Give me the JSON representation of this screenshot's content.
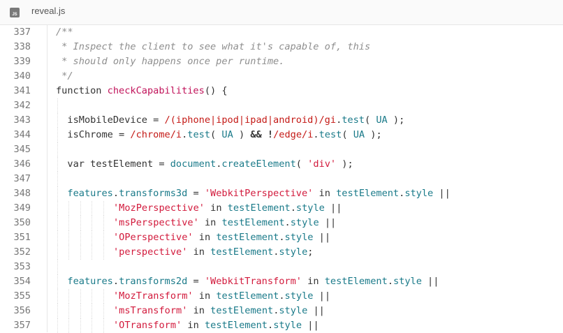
{
  "tab": {
    "icon_text": "JS",
    "filename": "reveal.js"
  },
  "lines": [
    {
      "num": "337",
      "indent": 1,
      "tokens": [
        {
          "t": "/**",
          "c": "com"
        }
      ]
    },
    {
      "num": "338",
      "indent": 1,
      "tokens": [
        {
          "t": " * Inspect the client to see what it's capable of, this",
          "c": "com"
        }
      ]
    },
    {
      "num": "339",
      "indent": 1,
      "tokens": [
        {
          "t": " * should only happens once per runtime.",
          "c": "com"
        }
      ]
    },
    {
      "num": "340",
      "indent": 1,
      "tokens": [
        {
          "t": " */",
          "c": "com"
        }
      ]
    },
    {
      "num": "341",
      "indent": 1,
      "tokens": [
        {
          "t": "function ",
          "c": "kw"
        },
        {
          "t": "checkCapabilities",
          "c": "fn"
        },
        {
          "t": "() {",
          "c": ""
        }
      ]
    },
    {
      "num": "342",
      "indent": 1,
      "tokens": []
    },
    {
      "num": "343",
      "indent": 2,
      "tokens": [
        {
          "t": "isMobileDevice = ",
          "c": ""
        },
        {
          "t": "/(iphone|ipod|ipad|android)/gi",
          "c": "re"
        },
        {
          "t": ".",
          "c": ""
        },
        {
          "t": "test",
          "c": "prop"
        },
        {
          "t": "( ",
          "c": ""
        },
        {
          "t": "UA",
          "c": "prop"
        },
        {
          "t": " );",
          "c": ""
        }
      ]
    },
    {
      "num": "344",
      "indent": 2,
      "tokens": [
        {
          "t": "isChrome = ",
          "c": ""
        },
        {
          "t": "/chrome/i",
          "c": "re"
        },
        {
          "t": ".",
          "c": ""
        },
        {
          "t": "test",
          "c": "prop"
        },
        {
          "t": "( ",
          "c": ""
        },
        {
          "t": "UA",
          "c": "prop"
        },
        {
          "t": " ) ",
          "c": ""
        },
        {
          "t": "&&",
          "c": "bold"
        },
        {
          "t": " ",
          "c": ""
        },
        {
          "t": "!",
          "c": "bold"
        },
        {
          "t": "/edge/i",
          "c": "re"
        },
        {
          "t": ".",
          "c": ""
        },
        {
          "t": "test",
          "c": "prop"
        },
        {
          "t": "( ",
          "c": ""
        },
        {
          "t": "UA",
          "c": "prop"
        },
        {
          "t": " );",
          "c": ""
        }
      ]
    },
    {
      "num": "345",
      "indent": 2,
      "tokens": []
    },
    {
      "num": "346",
      "indent": 2,
      "tokens": [
        {
          "t": "var ",
          "c": "kw"
        },
        {
          "t": "testElement = ",
          "c": ""
        },
        {
          "t": "document",
          "c": "prop"
        },
        {
          "t": ".",
          "c": ""
        },
        {
          "t": "createElement",
          "c": "prop"
        },
        {
          "t": "( ",
          "c": ""
        },
        {
          "t": "'div'",
          "c": "str"
        },
        {
          "t": " );",
          "c": ""
        }
      ]
    },
    {
      "num": "347",
      "indent": 2,
      "tokens": []
    },
    {
      "num": "348",
      "indent": 2,
      "tokens": [
        {
          "t": "features",
          "c": "prop"
        },
        {
          "t": ".",
          "c": ""
        },
        {
          "t": "transforms3d",
          "c": "prop"
        },
        {
          "t": " = ",
          "c": ""
        },
        {
          "t": "'WebkitPerspective'",
          "c": "str"
        },
        {
          "t": " in ",
          "c": "kw"
        },
        {
          "t": "testElement",
          "c": "prop"
        },
        {
          "t": ".",
          "c": ""
        },
        {
          "t": "style",
          "c": "prop"
        },
        {
          "t": " ||",
          "c": ""
        }
      ]
    },
    {
      "num": "349",
      "indent": 6,
      "tokens": [
        {
          "t": "'MozPerspective'",
          "c": "str"
        },
        {
          "t": " in ",
          "c": "kw"
        },
        {
          "t": "testElement",
          "c": "prop"
        },
        {
          "t": ".",
          "c": ""
        },
        {
          "t": "style",
          "c": "prop"
        },
        {
          "t": " ||",
          "c": ""
        }
      ]
    },
    {
      "num": "350",
      "indent": 6,
      "tokens": [
        {
          "t": "'msPerspective'",
          "c": "str"
        },
        {
          "t": " in ",
          "c": "kw"
        },
        {
          "t": "testElement",
          "c": "prop"
        },
        {
          "t": ".",
          "c": ""
        },
        {
          "t": "style",
          "c": "prop"
        },
        {
          "t": " ||",
          "c": ""
        }
      ]
    },
    {
      "num": "351",
      "indent": 6,
      "tokens": [
        {
          "t": "'OPerspective'",
          "c": "str"
        },
        {
          "t": " in ",
          "c": "kw"
        },
        {
          "t": "testElement",
          "c": "prop"
        },
        {
          "t": ".",
          "c": ""
        },
        {
          "t": "style",
          "c": "prop"
        },
        {
          "t": " ||",
          "c": ""
        }
      ]
    },
    {
      "num": "352",
      "indent": 6,
      "tokens": [
        {
          "t": "'perspective'",
          "c": "str"
        },
        {
          "t": " in ",
          "c": "kw"
        },
        {
          "t": "testElement",
          "c": "prop"
        },
        {
          "t": ".",
          "c": ""
        },
        {
          "t": "style",
          "c": "prop"
        },
        {
          "t": ";",
          "c": ""
        }
      ]
    },
    {
      "num": "353",
      "indent": 2,
      "tokens": []
    },
    {
      "num": "354",
      "indent": 2,
      "tokens": [
        {
          "t": "features",
          "c": "prop"
        },
        {
          "t": ".",
          "c": ""
        },
        {
          "t": "transforms2d",
          "c": "prop"
        },
        {
          "t": " = ",
          "c": ""
        },
        {
          "t": "'WebkitTransform'",
          "c": "str"
        },
        {
          "t": " in ",
          "c": "kw"
        },
        {
          "t": "testElement",
          "c": "prop"
        },
        {
          "t": ".",
          "c": ""
        },
        {
          "t": "style",
          "c": "prop"
        },
        {
          "t": " ||",
          "c": ""
        }
      ]
    },
    {
      "num": "355",
      "indent": 6,
      "tokens": [
        {
          "t": "'MozTransform'",
          "c": "str"
        },
        {
          "t": " in ",
          "c": "kw"
        },
        {
          "t": "testElement",
          "c": "prop"
        },
        {
          "t": ".",
          "c": ""
        },
        {
          "t": "style",
          "c": "prop"
        },
        {
          "t": " ||",
          "c": ""
        }
      ]
    },
    {
      "num": "356",
      "indent": 6,
      "tokens": [
        {
          "t": "'msTransform'",
          "c": "str"
        },
        {
          "t": " in ",
          "c": "kw"
        },
        {
          "t": "testElement",
          "c": "prop"
        },
        {
          "t": ".",
          "c": ""
        },
        {
          "t": "style",
          "c": "prop"
        },
        {
          "t": " ||",
          "c": ""
        }
      ]
    },
    {
      "num": "357",
      "indent": 6,
      "tokens": [
        {
          "t": "'OTransform'",
          "c": "str"
        },
        {
          "t": " in ",
          "c": "kw"
        },
        {
          "t": "testElement",
          "c": "prop"
        },
        {
          "t": ".",
          "c": ""
        },
        {
          "t": "style",
          "c": "prop"
        },
        {
          "t": " ||",
          "c": ""
        }
      ]
    }
  ]
}
